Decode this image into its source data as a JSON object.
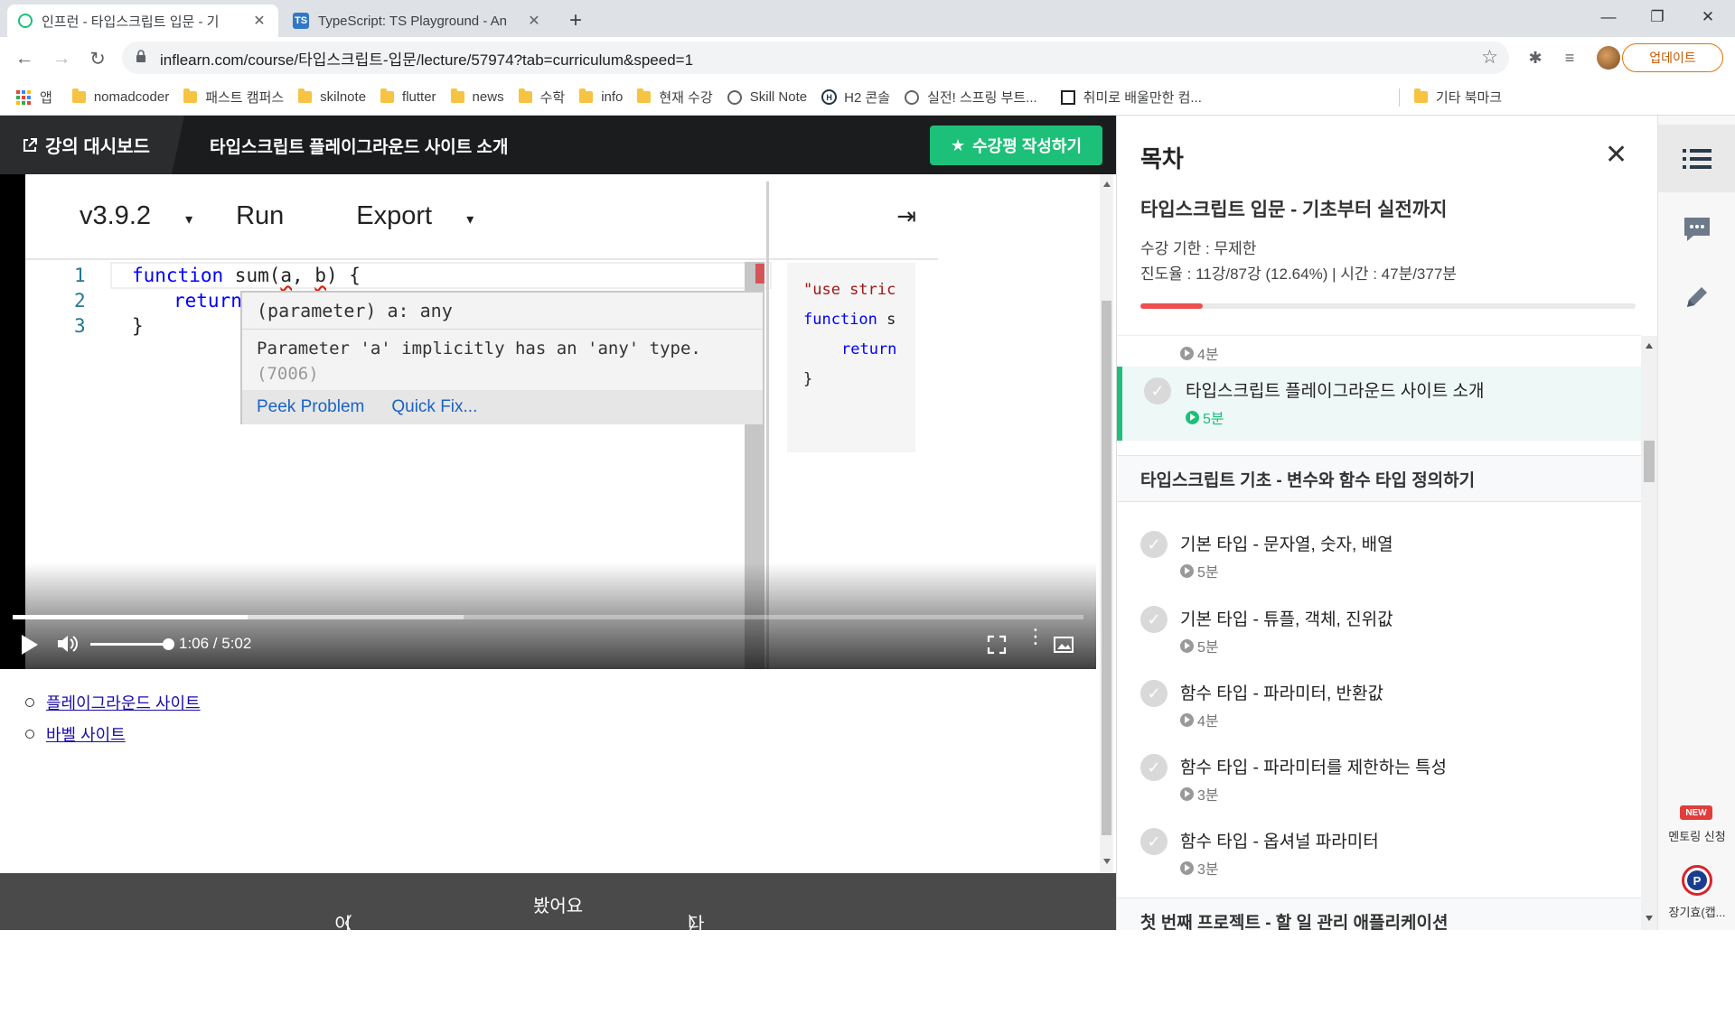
{
  "browser": {
    "tabs": [
      {
        "title": "인프런 - 타입스크립트 입문 - 기",
        "favicon": "inflearn-icon"
      },
      {
        "title": "TypeScript: TS Playground - An",
        "favicon": "TS"
      }
    ],
    "new_tab": "+",
    "url": "inflearn.com/course/타입스크립트-입문/lecture/57974?tab=curriculum&speed=1",
    "update_label": "업데이트",
    "bookmarks": [
      "앱",
      "nomadcoder",
      "패스트 캠퍼스",
      "skilnote",
      "flutter",
      "news",
      "수학",
      "info",
      "현재 수강",
      "Skill Note",
      "H2 콘솔",
      "실전! 스프링 부트...",
      "취미로 배울만한 컴...",
      "기타 북마크"
    ]
  },
  "course_header": {
    "dashboard_label": "강의 대시보드",
    "lecture_title": "타입스크립트 플레이그라운드 사이트 소개",
    "review_label": "수강평 작성하기"
  },
  "playground": {
    "version": "v3.9.2",
    "run": "Run",
    "export": "Export",
    "collapse_glyph": "⇥",
    "line_numbers": [
      "1",
      "2",
      "3"
    ],
    "code": {
      "l1_kw": "function",
      "l1_a": " sum(",
      "l1_b": "a",
      "l1_c": ", ",
      "l1_d": "b",
      "l1_e": ") {",
      "l2_kw": "return",
      "l2_rest": " a",
      "l3": "}"
    },
    "tooltip": {
      "signature": "(parameter) a: any",
      "message": "Parameter 'a' implicitly has an 'any' type.",
      "code": "(7006)",
      "peek": "Peek Problem",
      "quickfix": "Quick Fix..."
    },
    "output": {
      "l1": "\"use stric",
      "l2_kw": "function",
      "l2_rest": " s",
      "l3_kw": "return",
      "l4": "}"
    }
  },
  "video": {
    "time": "1:06 / 5:02",
    "progress": 0.219,
    "buffered": 0.421,
    "volume": 0.95
  },
  "description": {
    "links": [
      "플레이그라운드 사이트",
      "바벨 사이트"
    ]
  },
  "bottom_nav": {
    "prev": "이전 강의",
    "watched": "봤어요",
    "next": "다음 강의"
  },
  "sidebar": {
    "title": "목차",
    "course_title": "타입스크립트 입문 - 기초부터 실전까지",
    "limit": "수강 기한 : 무제한",
    "progress_text": "진도율 : 11강/87강 (12.64%) | 시간 : 47분/377분",
    "progress": 0.1264,
    "prev_duration": "4분",
    "current": {
      "title": "타입스크립트 플레이그라운드 사이트 소개",
      "duration": "5분"
    },
    "section": "타입스크립트 기초 - 변수와 함수 타입 정의하기",
    "lessons": [
      {
        "title": "기본 타입 - 문자열, 숫자, 배열",
        "duration": "5분"
      },
      {
        "title": "기본 타입 - 튜플, 객체, 진위값",
        "duration": "5분"
      },
      {
        "title": "함수 타입 - 파라미터, 반환값",
        "duration": "4분"
      },
      {
        "title": "함수 타입 - 파라미터를 제한하는 특성",
        "duration": "3분"
      },
      {
        "title": "함수 타입 - 옵셔널 파라미터",
        "duration": "3분"
      }
    ],
    "next_section": "첫 번째 프로젝트 - 할 일 관리 애플리케이션"
  },
  "rail": {
    "new_badge": "NEW",
    "mentoring": "멘토링 신청",
    "user": "장기효(캡..."
  },
  "colors": {
    "accent": "#1dc078",
    "progress": "#ec4f4f",
    "header": "#1b1c1d"
  }
}
